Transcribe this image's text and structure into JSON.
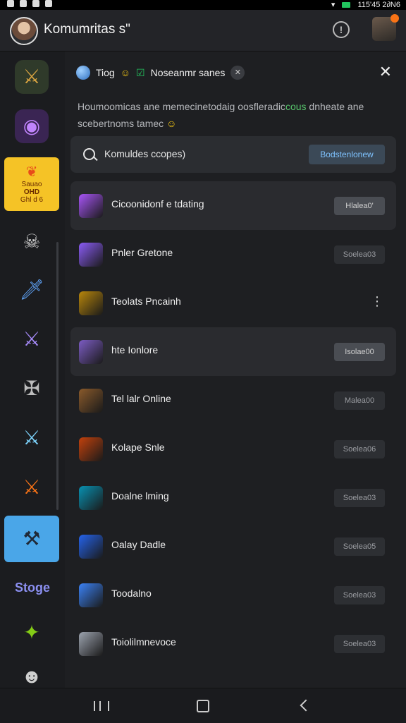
{
  "app": {
    "title": "Komumritas s\"",
    "status_time": "115'45 2∂N6"
  },
  "panel": {
    "header_label": "Tiog",
    "header_tag": "Noseanmr sanes",
    "description": "Houmoomicas ane memecinetodaig oosfleradic",
    "description_green": "cous",
    "description_tail": "dnheate ane scebertnoms tamec"
  },
  "search": {
    "placeholder": "Komuldes ccopes)",
    "button_label": "Bodstenlonew"
  },
  "communities": [
    {
      "name": "Cicoonidonf e tdating",
      "action": "Hlalea0'",
      "color": "#a855f7",
      "highlight": true,
      "strong": true
    },
    {
      "name": "Pnler Gretone",
      "action": "Soelea03",
      "color": "#8b5cf6",
      "highlight": false,
      "strong": false
    },
    {
      "name": "Teolats Pncainh",
      "action": "",
      "color": "#b8860b",
      "highlight": false,
      "strong": false,
      "kebab": true
    },
    {
      "name": "hte Ionlore",
      "action": "Isolae00",
      "color": "#7c5cc4",
      "highlight": true,
      "strong": true
    },
    {
      "name": "Tel lalr Online",
      "action": "Malea00",
      "color": "#8a5a2b",
      "highlight": false,
      "strong": false
    },
    {
      "name": "Kolape Snle",
      "action": "Soelea06",
      "color": "#c2410c",
      "highlight": false,
      "strong": false
    },
    {
      "name": "Doalne lming",
      "action": "Soelea03",
      "color": "#0891b2",
      "highlight": false,
      "strong": false
    },
    {
      "name": "Oalay Dadle",
      "action": "Soelea05",
      "color": "#2563eb",
      "highlight": false,
      "strong": false
    },
    {
      "name": "Toodalno",
      "action": "Soelea03",
      "color": "#3b82f6",
      "highlight": false,
      "strong": false
    },
    {
      "name": "Toiolilmnevoce",
      "action": "Soelea03",
      "color": "#9ca3af",
      "highlight": false,
      "strong": false
    }
  ],
  "rail": {
    "yellow_text_1": "Sauao",
    "yellow_text_2": "OHD",
    "yellow_text_3": "Ghl d 6",
    "bottom_label": "Stoge"
  }
}
